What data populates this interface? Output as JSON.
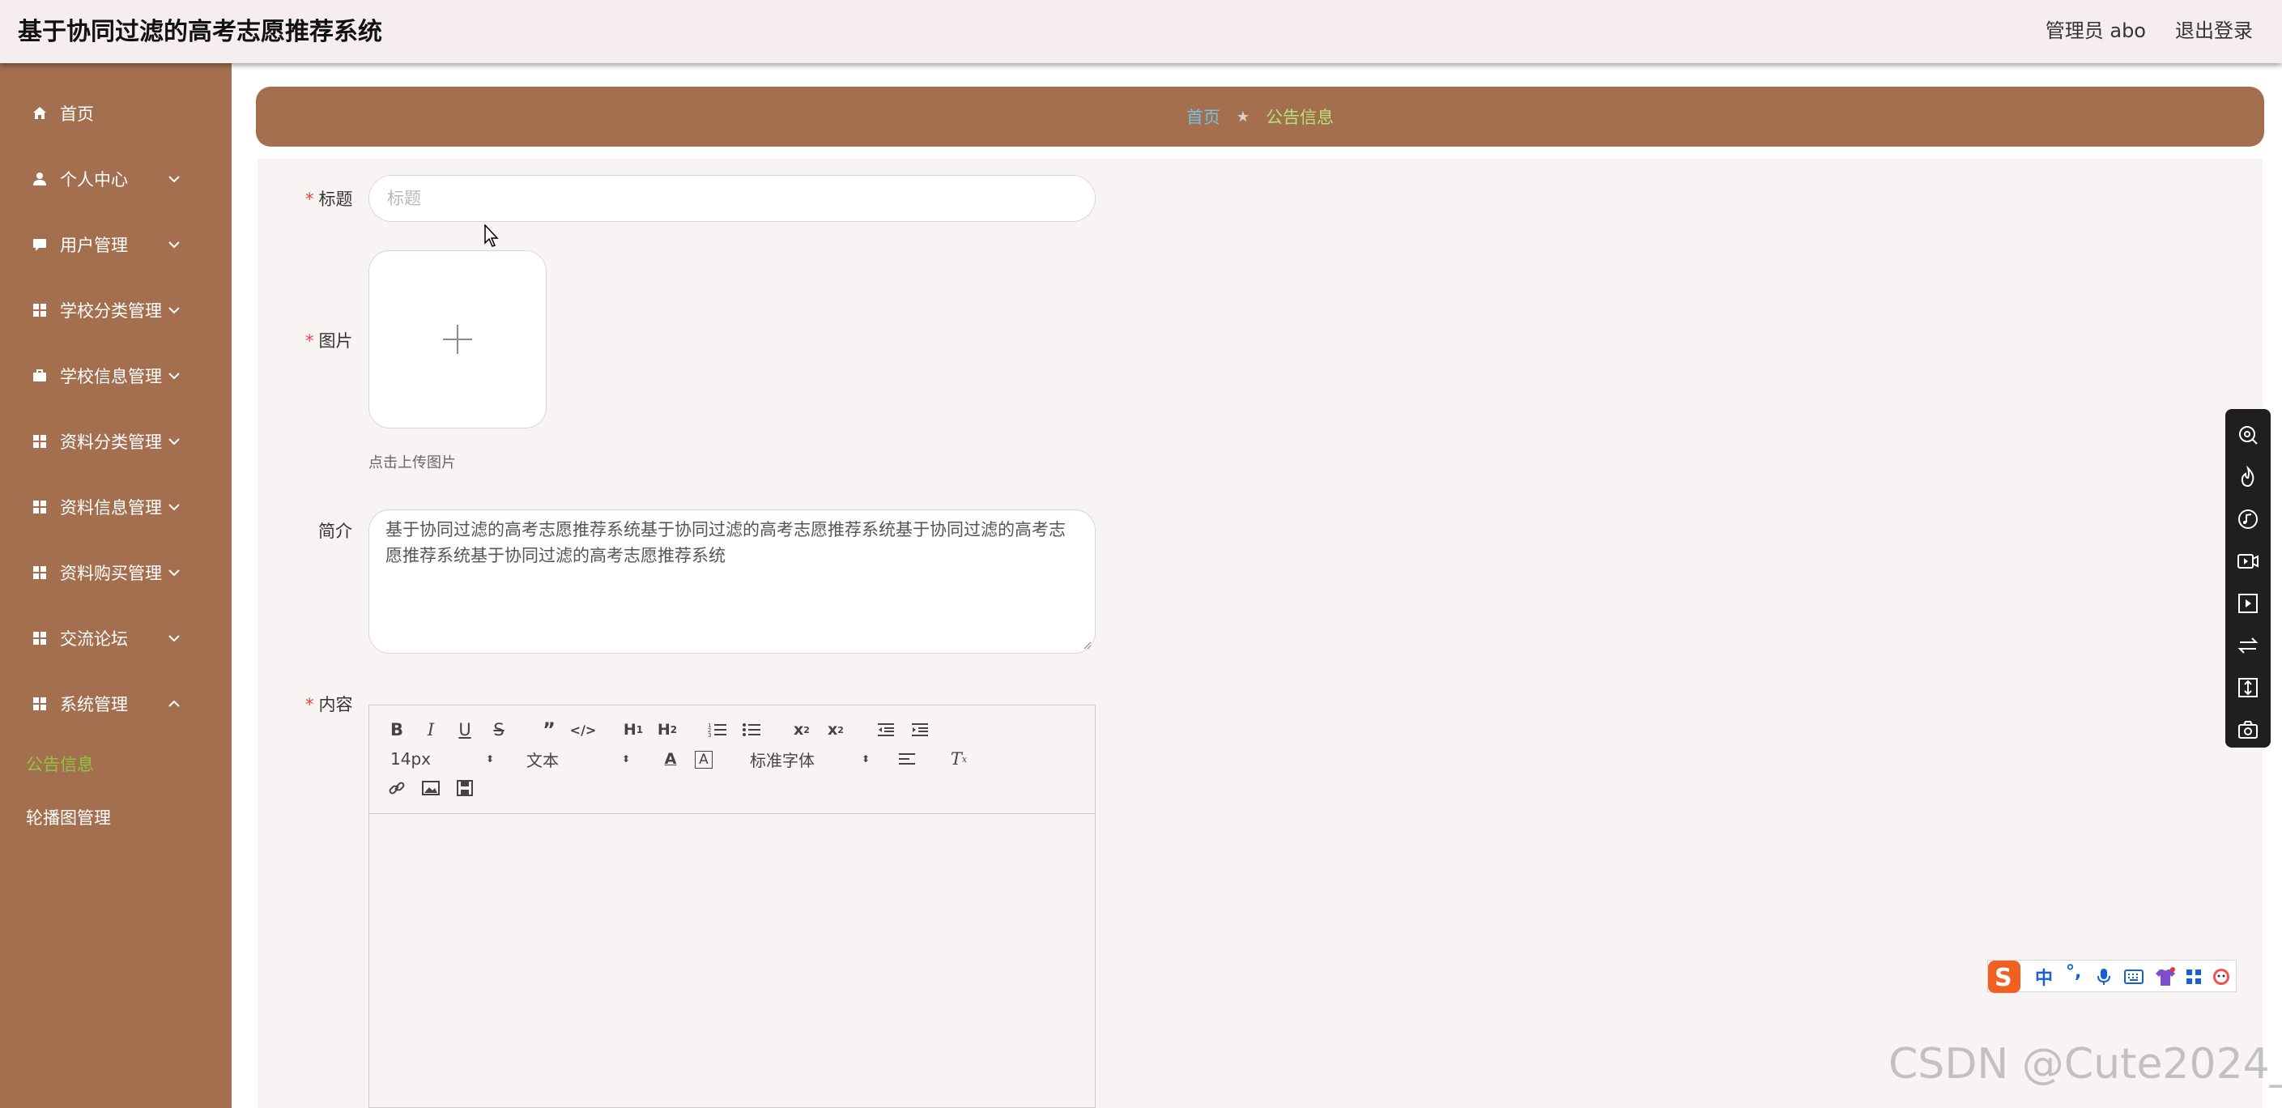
{
  "header": {
    "app_title": "基于协同过滤的高考志愿推荐系统",
    "user_label": "管理员 abo",
    "logout_label": "退出登录"
  },
  "sidebar": {
    "items": [
      {
        "label": "首页",
        "icon": "home-icon",
        "expandable": false
      },
      {
        "label": "个人中心",
        "icon": "user-icon",
        "expandable": true
      },
      {
        "label": "用户管理",
        "icon": "chat-icon",
        "expandable": true
      },
      {
        "label": "学校分类管理",
        "icon": "grid-icon",
        "expandable": true
      },
      {
        "label": "学校信息管理",
        "icon": "briefcase-icon",
        "expandable": true
      },
      {
        "label": "资料分类管理",
        "icon": "grid-icon",
        "expandable": true
      },
      {
        "label": "资料信息管理",
        "icon": "grid-icon",
        "expandable": true
      },
      {
        "label": "资料购买管理",
        "icon": "grid-icon",
        "expandable": true
      },
      {
        "label": "交流论坛",
        "icon": "grid-icon",
        "expandable": true
      },
      {
        "label": "系统管理",
        "icon": "grid-icon",
        "expandable": true
      }
    ],
    "sub_items": [
      {
        "label": "公告信息",
        "active": true
      },
      {
        "label": "轮播图管理",
        "active": false
      }
    ]
  },
  "breadcrumb": {
    "home": "首页",
    "current": "公告信息"
  },
  "form": {
    "title_label": "标题",
    "title_placeholder": "标题",
    "title_value": "",
    "image_label": "图片",
    "upload_hint": "点击上传图片",
    "intro_label": "简介",
    "intro_value": "基于协同过滤的高考志愿推荐系统基于协同过滤的高考志愿推荐系统基于协同过滤的高考志愿推荐系统基于协同过滤的高考志愿推荐系统",
    "content_label": "内容"
  },
  "editor": {
    "font_size": "14px",
    "heading": "文本",
    "font_family": "标准字体"
  },
  "watermark": "CSDN @Cute2024_",
  "colors": {
    "accent": "#a46f4f",
    "active_green": "#8dc63f",
    "breadcrumb_home": "#6fc3df",
    "required": "#e04848"
  }
}
